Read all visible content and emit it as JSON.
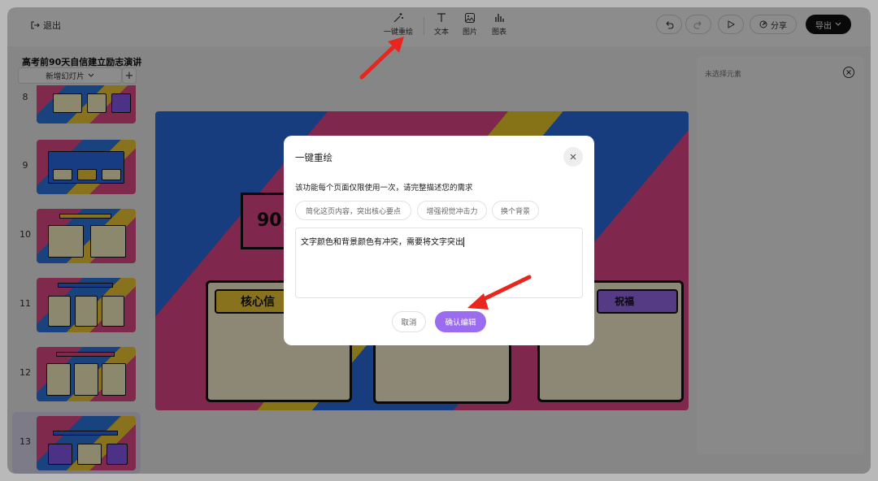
{
  "header": {
    "exit_label": "退出",
    "tools": [
      {
        "label": "一键重绘",
        "icon": "magic-wand-icon"
      },
      {
        "label": "文本",
        "icon": "text-icon"
      },
      {
        "label": "图片",
        "icon": "image-icon"
      },
      {
        "label": "图表",
        "icon": "chart-icon"
      }
    ],
    "share_label": "分享",
    "export_label": "导出"
  },
  "sidebar": {
    "doc_title": "高考前90天自信建立励志演讲",
    "add_slide_label": "新增幻灯片",
    "add_button_label": "+",
    "slides": [
      {
        "number": "8"
      },
      {
        "number": "9"
      },
      {
        "number": "10"
      },
      {
        "number": "11"
      },
      {
        "number": "12"
      },
      {
        "number": "13"
      }
    ]
  },
  "canvas": {
    "big_number": "90",
    "card_heading": "核心信",
    "card_heading_right": "祝福"
  },
  "right_panel": {
    "empty_label": "未选择元素"
  },
  "modal": {
    "title": "一键重绘",
    "description": "该功能每个页面仅限使用一次，请完整描述您的需求",
    "suggestions": [
      "简化这页内容，突出核心要点",
      "增强视觉冲击力",
      "换个背景"
    ],
    "input_value": "文字颜色和背景颜色有冲突，需要将文字突出",
    "cancel_label": "取消",
    "confirm_label": "确认编辑"
  },
  "colors": {
    "accent": "#9b6cf0",
    "annotation_arrow": "#e8261e"
  }
}
